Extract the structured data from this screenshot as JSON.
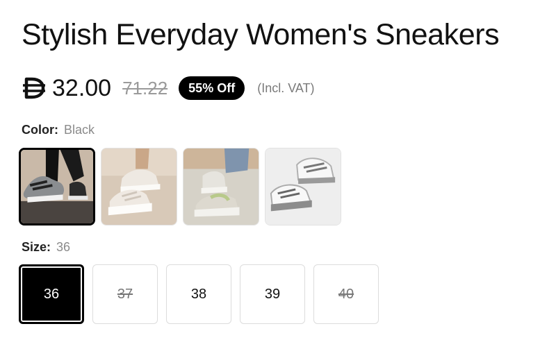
{
  "product": {
    "title": "Stylish Everyday Women's Sneakers",
    "currency_icon": "dirham-icon",
    "price": "32.00",
    "original_price": "71.22",
    "discount_badge": "55% Off",
    "vat_note": "(Incl. VAT)"
  },
  "color_option": {
    "label": "Color:",
    "selected_value": "Black",
    "swatches": [
      {
        "name": "black-sneaker-on-foot",
        "selected": true
      },
      {
        "name": "beige-sneaker-pair",
        "selected": false
      },
      {
        "name": "sage-sneaker-on-foot",
        "selected": false
      },
      {
        "name": "white-grey-sneaker-pair",
        "selected": false
      }
    ]
  },
  "size_option": {
    "label": "Size:",
    "selected_value": "36",
    "sizes": [
      {
        "value": "36",
        "state": "selected"
      },
      {
        "value": "37",
        "state": "unavailable"
      },
      {
        "value": "38",
        "state": "available"
      },
      {
        "value": "39",
        "state": "available"
      },
      {
        "value": "40",
        "state": "unavailable"
      }
    ]
  },
  "colors": {
    "accent": "#000000",
    "muted_text": "#8a8a8a",
    "border": "#dcdcdc"
  }
}
